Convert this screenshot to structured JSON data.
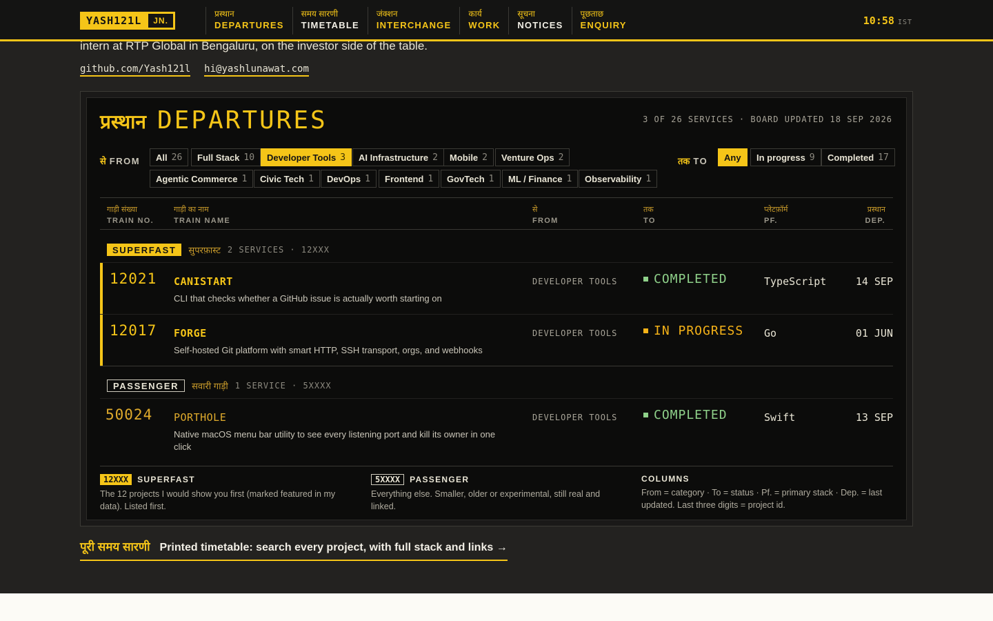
{
  "brand": {
    "name": "YASH121L",
    "suffix": "JN."
  },
  "nav": [
    {
      "hi": "प्रस्थान",
      "en": "DEPARTURES",
      "style": "yellow"
    },
    {
      "hi": "समय सारणी",
      "en": "TIMETABLE",
      "style": "white"
    },
    {
      "hi": "जंक्शन",
      "en": "INTERCHANGE",
      "style": "yellow"
    },
    {
      "hi": "कार्य",
      "en": "WORK",
      "style": "yellow"
    },
    {
      "hi": "सूचना",
      "en": "NOTICES",
      "style": "white"
    },
    {
      "hi": "पूछताछ",
      "en": "ENQUIRY",
      "style": "yellow"
    }
  ],
  "clock": {
    "time": "10:58",
    "zone": "IST"
  },
  "intro": {
    "text": "intern at RTP Global in Bengaluru, on the investor side of the table."
  },
  "links": {
    "github": "github.com/Yash121l",
    "email": "hi@yashlunawat.com"
  },
  "board": {
    "title_hi": "प्रस्थान",
    "title_en": "DEPARTURES",
    "meta": "3 OF 26 SERVICES · BOARD UPDATED 18 SEP 2026",
    "from_label": {
      "hi": "से",
      "en": "FROM"
    },
    "to_label": {
      "hi": "तक",
      "en": "TO"
    },
    "from_filters": [
      {
        "label": "All",
        "count": "26",
        "active": false
      },
      {
        "label": "Full Stack",
        "count": "10",
        "active": false
      },
      {
        "label": "Developer Tools",
        "count": "3",
        "active": true
      },
      {
        "label": "AI Infrastructure",
        "count": "2",
        "active": false
      },
      {
        "label": "Mobile",
        "count": "2",
        "active": false
      },
      {
        "label": "Venture Ops",
        "count": "2",
        "active": false
      },
      {
        "label": "Agentic Commerce",
        "count": "1",
        "active": false
      },
      {
        "label": "Civic Tech",
        "count": "1",
        "active": false
      },
      {
        "label": "DevOps",
        "count": "1",
        "active": false
      },
      {
        "label": "Frontend",
        "count": "1",
        "active": false
      },
      {
        "label": "GovTech",
        "count": "1",
        "active": false
      },
      {
        "label": "ML / Finance",
        "count": "1",
        "active": false
      },
      {
        "label": "Observability",
        "count": "1",
        "active": false
      }
    ],
    "to_filters": [
      {
        "label": "Any",
        "count": "",
        "active": true
      },
      {
        "label": "In progress",
        "count": "9",
        "active": false
      },
      {
        "label": "Completed",
        "count": "17",
        "active": false
      }
    ],
    "columns": [
      {
        "hi": "गाड़ी संख्या",
        "en": "TRAIN NO."
      },
      {
        "hi": "गाड़ी का नाम",
        "en": "TRAIN NAME"
      },
      {
        "hi": "से",
        "en": "FROM"
      },
      {
        "hi": "तक",
        "en": "TO"
      },
      {
        "hi": "प्लेटफ़ॉर्म",
        "en": "PF."
      },
      {
        "hi": "प्रस्थान",
        "en": "DEP."
      }
    ],
    "groups": {
      "superfast": {
        "badge": "SUPERFAST",
        "hi": "सुपरफ़ास्ट",
        "meta": "2 SERVICES · 12XXX"
      },
      "passenger": {
        "badge": "PASSENGER",
        "hi": "सवारी गाड़ी",
        "meta": "1 SERVICE · 5XXXX"
      }
    },
    "rows": [
      {
        "no": "12021",
        "name": "CANISTART",
        "desc": "CLI that checks whether a GitHub issue is actually worth starting on",
        "from": "DEVELOPER TOOLS",
        "status": "COMPLETED",
        "status_kind": "done",
        "pf": "TypeScript",
        "dep": "14 SEP"
      },
      {
        "no": "12017",
        "name": "FORGE",
        "desc": "Self-hosted Git platform with smart HTTP, SSH transport, orgs, and webhooks",
        "from": "DEVELOPER TOOLS",
        "status": "IN PROGRESS",
        "status_kind": "prog",
        "pf": "Go",
        "dep": "01 JUN"
      },
      {
        "no": "50024",
        "name": "PORTHOLE",
        "desc": "Native macOS menu bar utility to see every listening port and kill its owner in one click",
        "from": "DEVELOPER TOOLS",
        "status": "COMPLETED",
        "status_kind": "done",
        "pf": "Swift",
        "dep": "13 SEP"
      }
    ],
    "legend": [
      {
        "tag": "12XXX",
        "title": "SUPERFAST",
        "body": "The 12 projects I would show you first (marked featured in my data). Listed first."
      },
      {
        "tag": "5XXXX",
        "title": "PASSENGER",
        "body": "Everything else. Smaller, older or experimental, still real and linked."
      },
      {
        "tag": "",
        "title": "COLUMNS",
        "body": "From = category · To = status · Pf. = primary stack · Dep. = last updated. Last three digits = project id."
      }
    ]
  },
  "footer": {
    "hi": "पूरी समय सारणी",
    "en": "Printed timetable: search every project, with full stack and links →"
  },
  "colors": {
    "accent": "#f5c518",
    "completed": "#8fd18a",
    "in_progress": "#f5b218",
    "background": "#232220",
    "board": "#0c0c0b"
  }
}
